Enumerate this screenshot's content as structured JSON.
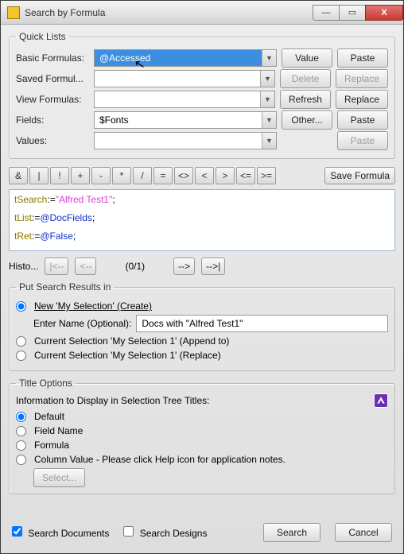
{
  "window": {
    "title": "Search by Formula"
  },
  "titlebar_buttons": {
    "min": "—",
    "max": "▭",
    "close": "X"
  },
  "quicklists": {
    "legend": "Quick Lists",
    "rows": [
      {
        "label": "Basic Formulas:",
        "value": "@Accessed",
        "btn1": "Value",
        "btn2": "Paste",
        "d1": false,
        "d2": false,
        "selected": true
      },
      {
        "label": "Saved Formul...",
        "value": "",
        "btn1": "Delete",
        "btn2": "Replace",
        "d1": true,
        "d2": true
      },
      {
        "label": "View Formulas:",
        "value": "",
        "btn1": "Refresh",
        "btn2": "Replace",
        "d1": false,
        "d2": false
      },
      {
        "label": "Fields:",
        "value": "$Fonts",
        "btn1": "Other...",
        "btn2": "Paste",
        "d1": false,
        "d2": false
      },
      {
        "label": "Values:",
        "value": "",
        "btn1": "",
        "btn2": "Paste",
        "d1": true,
        "d2": true
      }
    ]
  },
  "ops": [
    "&",
    "|",
    "!",
    "+",
    "-",
    "*",
    "/",
    "=",
    "<>",
    "<",
    ">",
    "<=",
    ">="
  ],
  "save_formula": "Save Formula",
  "code": {
    "l1a": "tSearch",
    "l1b": ":=",
    "l1c": "\"Alfred Test1\"",
    "l1d": ";",
    "l2a": "tList",
    "l2b": ":=",
    "l2c": "@DocFields",
    "l2d": ";",
    "l3a": "tRet",
    "l3b": ":=",
    "l3c": "@False",
    "l3d": ";"
  },
  "history": {
    "label": "Histo...",
    "count": "(0/1)",
    "first": "|<--",
    "prev": "<--",
    "next": "-->",
    "last": "-->|"
  },
  "results": {
    "legend": "Put Search Results in",
    "opt_new": "New 'My Selection' (Create)",
    "enter_name_label": "Enter Name (Optional):",
    "enter_name_value": "Docs with \"Alfred Test1\"",
    "opt_append": "Current Selection 'My Selection 1' (Append to)",
    "opt_replace": "Current Selection 'My Selection 1' (Replace)"
  },
  "titleopts": {
    "legend": "Title Options",
    "info": "Information to Display in Selection Tree Titles:",
    "opt_default": "Default",
    "opt_field": "Field Name",
    "opt_formula": "Formula",
    "opt_column": "Column Value -  Please click Help icon for application notes.",
    "select_btn": "Select..."
  },
  "footer": {
    "search_docs": "Search Documents",
    "search_designs": "Search Designs",
    "search": "Search",
    "cancel": "Cancel"
  }
}
